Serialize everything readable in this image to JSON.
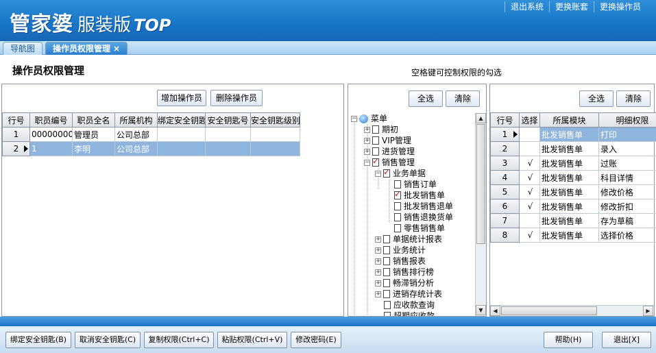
{
  "app": {
    "brand_main": "管家婆",
    "brand_sub": "服装版",
    "brand_top": "TOP",
    "top_menu": [
      "退出系统",
      "更换账套",
      "更换操作员"
    ]
  },
  "tabs": [
    {
      "label": "导航图"
    },
    {
      "label": "操作员权限管理",
      "close": "×"
    }
  ],
  "page": {
    "title": "操作员权限管理",
    "hint": "空格键可控制权限的勾选"
  },
  "left_panel": {
    "add_button": "增加操作员",
    "delete_button": "删除操作员",
    "columns": [
      "行号",
      "职员编号",
      "职员全名",
      "所属机构",
      "绑定安全钥匙",
      "安全钥匙号",
      "安全钥匙级别"
    ],
    "rows": [
      {
        "n": "1",
        "code": "000000000",
        "name": "管理员",
        "org": "公司总部",
        "bind": "",
        "keyno": "",
        "level": ""
      },
      {
        "n": "2",
        "code": "1",
        "name": "李明",
        "org": "公司总部",
        "bind": "",
        "keyno": "",
        "level": ""
      }
    ]
  },
  "mid_panel": {
    "select_all": "全选",
    "clear": "清除",
    "tree": {
      "root": "菜单",
      "items": [
        "期初",
        "VIP管理",
        "进货管理",
        "销售管理",
        "业务单据",
        "销售订单",
        "批发销售单",
        "批发销售退单",
        "销售退换货单",
        "零售销售单",
        "单据统计报表",
        "业务统计",
        "销售报表",
        "销售排行榜",
        "畅滞销分析",
        "进销存统计表",
        "应收款查询",
        "超期应收款"
      ]
    }
  },
  "right_panel": {
    "select_all": "全选",
    "clear": "清除",
    "columns": [
      "行号",
      "选择",
      "所属模块",
      "明细权限"
    ],
    "rows": [
      {
        "n": "1",
        "sel": "",
        "module": "批发销售单",
        "perm": "打印"
      },
      {
        "n": "2",
        "sel": "",
        "module": "批发销售单",
        "perm": "录入"
      },
      {
        "n": "3",
        "sel": "√",
        "module": "批发销售单",
        "perm": "过账"
      },
      {
        "n": "4",
        "sel": "√",
        "module": "批发销售单",
        "perm": "科目详情"
      },
      {
        "n": "5",
        "sel": "√",
        "module": "批发销售单",
        "perm": "修改价格"
      },
      {
        "n": "6",
        "sel": "√",
        "module": "批发销售单",
        "perm": "修改折扣"
      },
      {
        "n": "7",
        "sel": "",
        "module": "批发销售单",
        "perm": "存为草稿"
      },
      {
        "n": "8",
        "sel": "√",
        "module": "批发销售单",
        "perm": "选择价格"
      }
    ]
  },
  "footer": {
    "bind_key": "绑定安全钥匙(B)",
    "unbind_key": "取消安全钥匙(C)",
    "copy_perm": "复制权限(Ctrl+C)",
    "paste_perm": "粘贴权限(Ctrl+V)",
    "change_pwd": "修改密码(E)",
    "help": "帮助(H)",
    "exit": "退出[X]"
  }
}
